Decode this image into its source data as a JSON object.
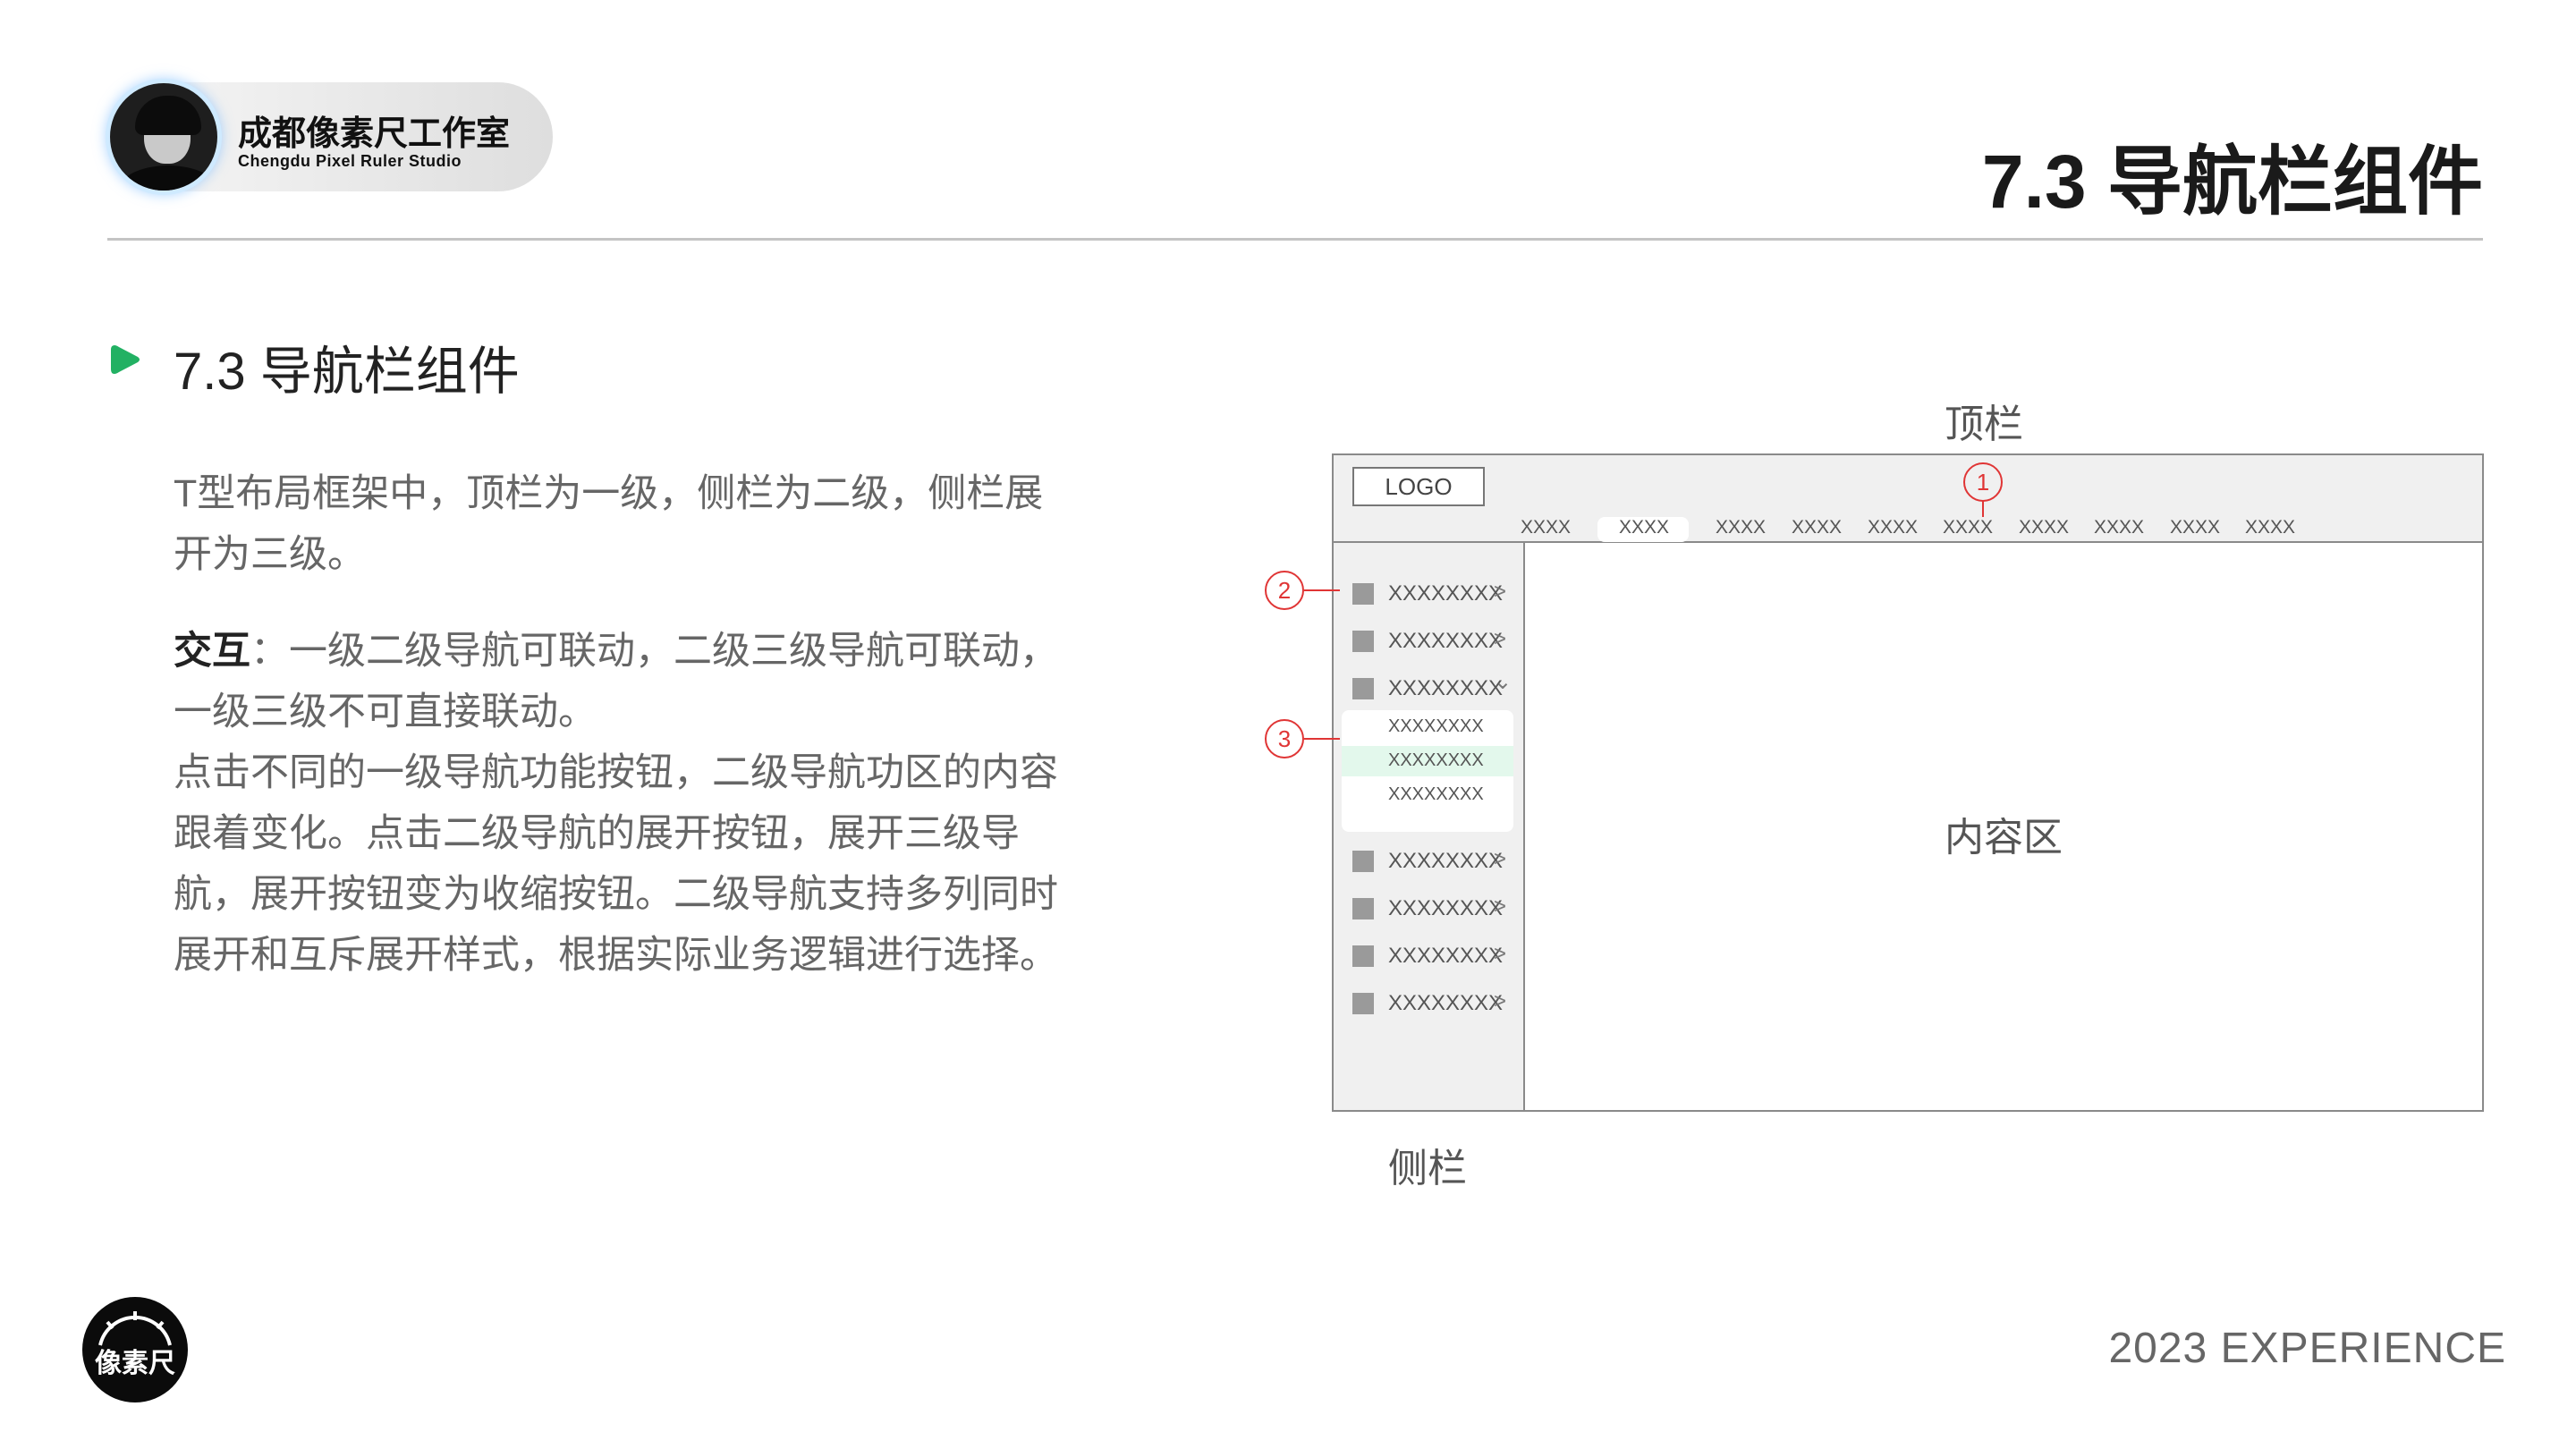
{
  "header": {
    "brand_name_cn": "成都像素尺工作室",
    "brand_name_en": "Chengdu Pixel Ruler Studio",
    "title": "7.3 导航栏组件"
  },
  "section": {
    "title": "7.3 导航栏组件",
    "paragraph1": "T型布局框架中，顶栏为一级，侧栏为二级，侧栏展开为三级。",
    "paragraph2_lead": "交互",
    "paragraph2_colon": "：",
    "paragraph2_body": "一级二级导航可联动，二级三级导航可联动，一级三级不可直接联动。",
    "paragraph3": "点击不同的一级导航功能按钮，二级导航功区的内容跟着变化。点击二级导航的展开按钮，展开三级导航，展开按钮变为收缩按钮。二级导航支持多列同时展开和互斥展开样式，根据实际业务逻辑进行选择。"
  },
  "diagram": {
    "label_top": "顶栏",
    "label_side": "侧栏",
    "label_content": "内容区",
    "logo": "LOGO",
    "top_items": [
      "XXXX",
      "XXXX",
      "XXXX",
      "XXXX",
      "XXXX",
      "XXXX",
      "XXXX",
      "XXXX",
      "XXXX",
      "XXXX"
    ],
    "active_top_index": 1,
    "side_items": [
      {
        "label": "XXXXXXXX",
        "chevron": ">"
      },
      {
        "label": "XXXXXXXX",
        "chevron": ">"
      },
      {
        "label": "XXXXXXXX",
        "chevron": "⌄"
      },
      {
        "label": "XXXXXXXX",
        "chevron": ">"
      },
      {
        "label": "XXXXXXXX",
        "chevron": ">"
      },
      {
        "label": "XXXXXXXX",
        "chevron": ">"
      },
      {
        "label": "XXXXXXXX",
        "chevron": ">"
      }
    ],
    "sub_items": [
      "XXXXXXXX",
      "XXXXXXXX",
      "XXXXXXXX"
    ],
    "active_sub_index": 1,
    "callouts": [
      "1",
      "2",
      "3"
    ],
    "colors": {
      "frame": "#8a8a8a",
      "panel": "#f0f0f0",
      "callout": "#e03535",
      "active_sub": "#e3f8ec",
      "accent": "#22b163"
    }
  },
  "footer": {
    "text": "2023  EXPERIENCE",
    "logo_chars": "像素尺"
  }
}
